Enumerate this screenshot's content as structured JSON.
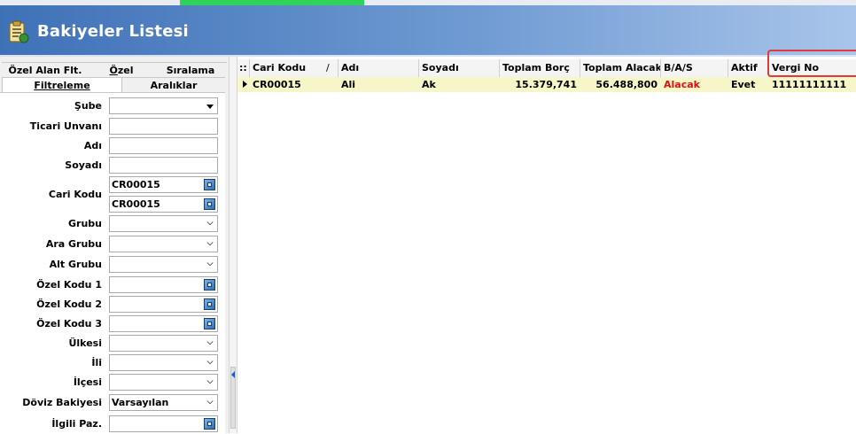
{
  "window": {
    "title": "Bakiyeler Listesi",
    "icon": "clipboard-report-icon"
  },
  "tabs_row1": [
    "Özel Alan Flt.",
    "Özel",
    "Sıralama"
  ],
  "tabs_row2": [
    "Filtreleme",
    "Aralıklar"
  ],
  "active_tab": "Filtreleme",
  "form": {
    "sube_label": "Şube",
    "ticari_unvani_label": "Ticari Unvanı",
    "adi_label": "Adı",
    "soyadi_label": "Soyadı",
    "cari_kodu_label": "Cari Kodu",
    "cari_kodu_from": "CR00015",
    "cari_kodu_to": "CR00015",
    "grubu_label": "Grubu",
    "ara_grubu_label": "Ara Grubu",
    "alt_grubu_label": "Alt Grubu",
    "ozel_kodu1_label": "Özel Kodu 1",
    "ozel_kodu2_label": "Özel Kodu 2",
    "ozel_kodu3_label": "Özel Kodu 3",
    "ulkesi_label": "Ülkesi",
    "ili_label": "İli",
    "ilcesi_label": "İlçesi",
    "doviz_bakiyesi_label": "Döviz Bakiyesi",
    "doviz_bakiyesi_value": "Varsayılan",
    "ilgili_paz_label": "İlgili Paz."
  },
  "grid": {
    "header_handle": "::",
    "sort_indicator": "/",
    "columns": [
      "Cari Kodu",
      "Adı",
      "Soyadı",
      "Toplam Borç",
      "Toplam Alacak",
      "B/A/S",
      "Aktif",
      "Vergi No"
    ],
    "rows": [
      {
        "cari_kodu": "CR00015",
        "adi": "Ali",
        "soyadi": "Ak",
        "toplam_borc": "15.379,741",
        "toplam_alacak": "56.488,800",
        "bas": "Alacak",
        "aktif": "Evet",
        "vergi_no": "11111111111"
      }
    ]
  },
  "colors": {
    "header_gradient_start": "#3f71b7",
    "header_gradient_end": "#a9c5ea",
    "selected_row": "#f6f6c8",
    "alacak_text": "#e01010",
    "highlight_box": "#e03a3a"
  }
}
